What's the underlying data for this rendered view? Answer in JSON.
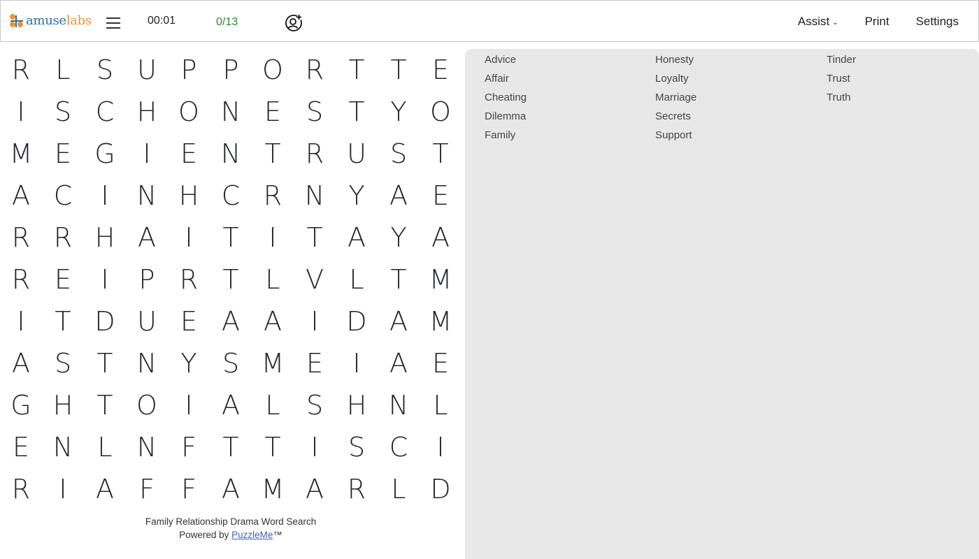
{
  "header": {
    "logo_text_1": "amuse",
    "logo_text_2": "labs",
    "timer": "00:01",
    "progress": "0/13",
    "nav": [
      {
        "label": "Assist",
        "has_dropdown": true
      },
      {
        "label": "Print"
      },
      {
        "label": "Settings"
      }
    ]
  },
  "grid": [
    [
      "R",
      "L",
      "S",
      "U",
      "P",
      "P",
      "O",
      "R",
      "T",
      "T",
      "E"
    ],
    [
      "I",
      "S",
      "C",
      "H",
      "O",
      "N",
      "E",
      "S",
      "T",
      "Y",
      "O"
    ],
    [
      "M",
      "E",
      "G",
      "I",
      "E",
      "N",
      "T",
      "R",
      "U",
      "S",
      "T"
    ],
    [
      "A",
      "C",
      "I",
      "N",
      "H",
      "C",
      "R",
      "N",
      "Y",
      "A",
      "E"
    ],
    [
      "R",
      "R",
      "H",
      "A",
      "I",
      "T",
      "I",
      "T",
      "A",
      "Y",
      "A"
    ],
    [
      "R",
      "E",
      "I",
      "P",
      "R",
      "T",
      "L",
      "V",
      "L",
      "T",
      "M"
    ],
    [
      "I",
      "T",
      "D",
      "U",
      "E",
      "A",
      "A",
      "I",
      "D",
      "A",
      "M"
    ],
    [
      "A",
      "S",
      "T",
      "N",
      "Y",
      "S",
      "M",
      "E",
      "I",
      "A",
      "E"
    ],
    [
      "G",
      "H",
      "T",
      "O",
      "I",
      "A",
      "L",
      "S",
      "H",
      "N",
      "L"
    ],
    [
      "E",
      "N",
      "L",
      "N",
      "F",
      "T",
      "T",
      "I",
      "S",
      "C",
      "I"
    ],
    [
      "R",
      "I",
      "A",
      "F",
      "F",
      "A",
      "M",
      "A",
      "R",
      "L",
      "D"
    ]
  ],
  "word_list": {
    "columns": [
      [
        "Advice",
        "Affair",
        "Cheating",
        "Dilemma",
        "Family"
      ],
      [
        "Honesty",
        "Loyalty",
        "Marriage",
        "Secrets",
        "Support"
      ],
      [
        "Tinder",
        "Trust",
        "Truth"
      ]
    ]
  },
  "footer": {
    "title": "Family Relationship Drama Word Search",
    "powered_prefix": "Powered by ",
    "powered_link": "PuzzleMe",
    "trademark": "™"
  },
  "colors": {
    "logo_blue": "#2b6ea6",
    "logo_orange": "#f0952b",
    "progress_green": "#2a8a2a",
    "panel_bg": "#e8e8e8",
    "link": "#3a62c8"
  }
}
